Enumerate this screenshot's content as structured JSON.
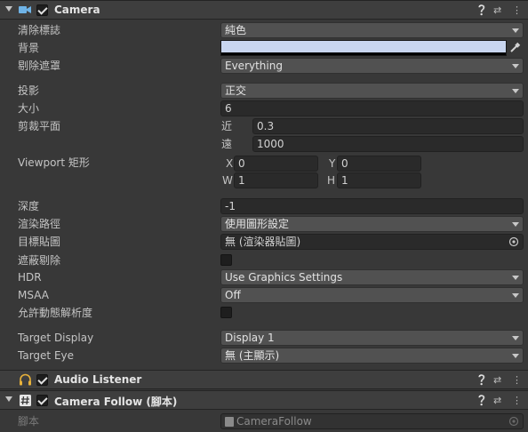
{
  "camera": {
    "title": "Camera",
    "fields": {
      "clear_flags": {
        "label": "清除標誌",
        "value": "純色"
      },
      "background": {
        "label": "背景",
        "color": "#c9d6f0"
      },
      "culling_mask": {
        "label": "剔除遮罩",
        "value": "Everything"
      },
      "projection": {
        "label": "投影",
        "value": "正交"
      },
      "size": {
        "label": "大小",
        "value": "6"
      },
      "clipping": {
        "label": "剪裁平面",
        "near_label": "近",
        "near": "0.3",
        "far_label": "遠",
        "far": "1000"
      },
      "viewport": {
        "label": "Viewport 矩形",
        "x_label": "X",
        "x": "0",
        "y_label": "Y",
        "y": "0",
        "w_label": "W",
        "w": "1",
        "h_label": "H",
        "h": "1"
      },
      "depth": {
        "label": "深度",
        "value": "-1"
      },
      "rendering_path": {
        "label": "渲染路徑",
        "value": "使用圖形設定"
      },
      "target_texture": {
        "label": "目標貼圖",
        "value": "無 (渲染器貼圖)"
      },
      "occlusion_culling": {
        "label": "遮蔽剔除"
      },
      "hdr": {
        "label": "HDR",
        "value": "Use Graphics Settings"
      },
      "msaa": {
        "label": "MSAA",
        "value": "Off"
      },
      "dynamic_resolution": {
        "label": "允許動態解析度"
      },
      "target_display": {
        "label": "Target Display",
        "value": "Display 1"
      },
      "target_eye": {
        "label": "Target Eye",
        "value": "無 (主顯示)"
      }
    }
  },
  "audio_listener": {
    "title": "Audio Listener"
  },
  "camera_follow": {
    "title": "Camera Follow (腳本)",
    "script_label": "腳本",
    "script_value": "CameraFollow"
  }
}
